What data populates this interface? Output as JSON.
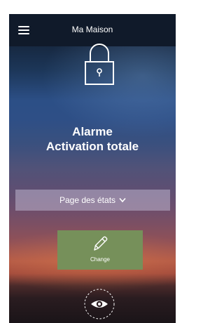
{
  "header": {
    "menu_icon": "hamburger-menu-icon",
    "title": "Ma Maison"
  },
  "alarm": {
    "icon": "padlock-icon",
    "line1": "Alarme",
    "line2": "Activation totale"
  },
  "states_dropdown": {
    "label": "Page des états",
    "icon": "chevron-down-icon"
  },
  "change_button": {
    "icon": "pencil-icon",
    "label": "Change"
  },
  "view_button": {
    "icon": "eye-icon"
  },
  "colors": {
    "topbar": "#101a2a",
    "change_button": "#76905a",
    "dropdown_bar": "rgba(190,180,205,0.55)",
    "text": "#ffffff"
  }
}
